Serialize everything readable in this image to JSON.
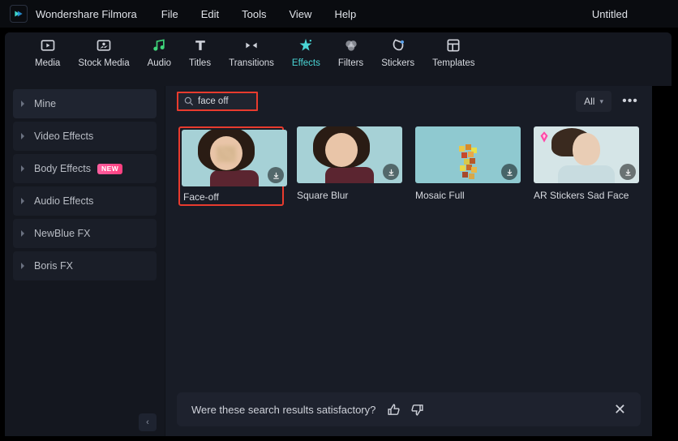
{
  "app_name": "Wondershare Filmora",
  "document_title": "Untitled",
  "menu": [
    "File",
    "Edit",
    "Tools",
    "View",
    "Help"
  ],
  "toolbar": [
    {
      "id": "media",
      "label": "Media"
    },
    {
      "id": "stock-media",
      "label": "Stock Media"
    },
    {
      "id": "audio",
      "label": "Audio"
    },
    {
      "id": "titles",
      "label": "Titles"
    },
    {
      "id": "transitions",
      "label": "Transitions"
    },
    {
      "id": "effects",
      "label": "Effects",
      "active": true
    },
    {
      "id": "filters",
      "label": "Filters"
    },
    {
      "id": "stickers",
      "label": "Stickers"
    },
    {
      "id": "templates",
      "label": "Templates"
    }
  ],
  "sidebar": [
    {
      "label": "Mine",
      "active": true
    },
    {
      "label": "Video Effects"
    },
    {
      "label": "Body Effects",
      "badge": "NEW"
    },
    {
      "label": "Audio Effects"
    },
    {
      "label": "NewBlue FX"
    },
    {
      "label": "Boris FX"
    }
  ],
  "search": {
    "value": "face off"
  },
  "filter": {
    "label": "All"
  },
  "results": [
    {
      "label": "Face-off",
      "highlight": true,
      "kind": "face-blur"
    },
    {
      "label": "Square Blur",
      "kind": "sq-blur"
    },
    {
      "label": "Mosaic Full",
      "kind": "mosaic"
    },
    {
      "label": "AR Stickers Sad Face",
      "kind": "sad",
      "badge": "star"
    }
  ],
  "feedback": {
    "question": "Were these search results satisfactory?"
  }
}
